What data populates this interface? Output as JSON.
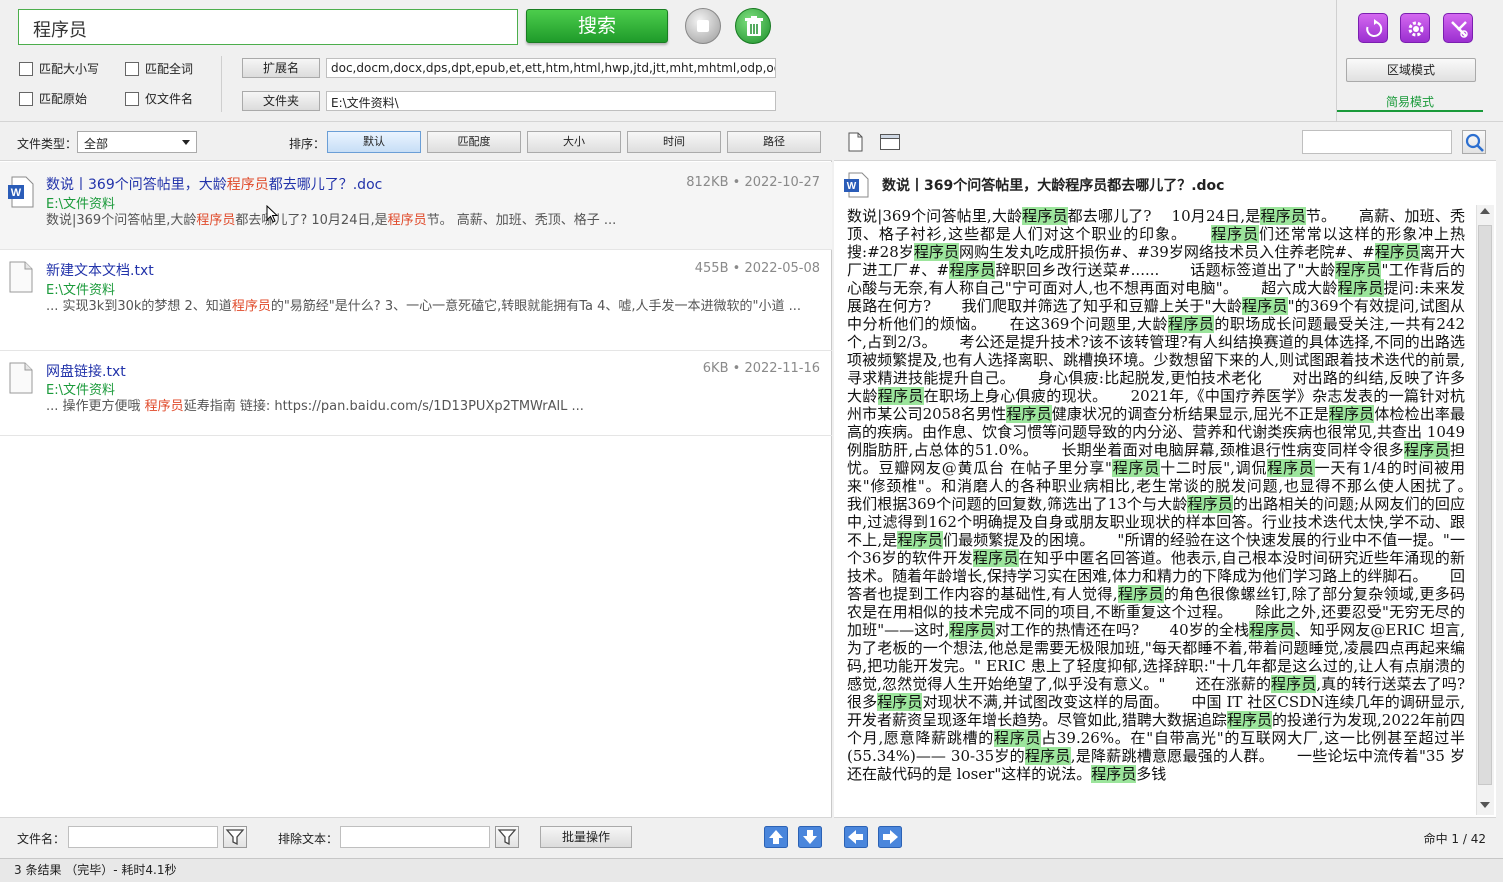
{
  "search": {
    "query": "程序员",
    "button_label": "搜索"
  },
  "options": {
    "match_case": "匹配大小写",
    "match_whole_word": "匹配全词",
    "match_original": "匹配原始",
    "filename_only": "仅文件名"
  },
  "extension": {
    "label": "扩展名",
    "value": "doc,docm,docx,dps,dpt,epub,et,ett,htm,html,hwp,jtd,jtt,mht,mhtml,odp,ods,odt,ofd,"
  },
  "folder": {
    "label": "文件夹",
    "value": "E:\\文件资料\\"
  },
  "modes": {
    "region": "区域模式",
    "simple": "简易模式"
  },
  "filter_bar": {
    "file_type_label": "文件类型：",
    "file_type_value": "全部",
    "sort_label": "排序：",
    "sort_options": [
      "默认",
      "匹配度",
      "大小",
      "时间",
      "路径"
    ]
  },
  "results": [
    {
      "title_pre": "数说丨369个问答帖里，大龄",
      "title_hl": "程序员",
      "title_post": "都去哪儿了？.doc",
      "path": "E:\\文件资料",
      "snippet_pre": "数说|369个问答帖里,大龄",
      "snippet_hl1": "程序员",
      "snippet_mid": "都去哪儿了? 10月24日,是",
      "snippet_hl2": "程序员",
      "snippet_post": "节。 高薪、加班、秃顶、格子 ...",
      "size": "812KB",
      "date": "2022-10-27"
    },
    {
      "title": "新建文本文档.txt",
      "path": "E:\\文件资料",
      "snippet_pre": "... 实现3k到30k的梦想 2、知道",
      "snippet_hl1": "程序员",
      "snippet_post": "的\"易筋经\"是什么? 3、一心一意死磕它,转眼就能拥有Ta 4、嘘,人手发一本进微软的\"小道 ...",
      "size": "455B",
      "date": "2022-05-08"
    },
    {
      "title": "网盘链接.txt",
      "path": "E:\\文件资料",
      "snippet_pre": "... 操作更方便哦 ",
      "snippet_hl1": "程序员",
      "snippet_post": "延寿指南 链接: https://pan.baidu.com/s/1D13PUXp2TMWrAlL ...",
      "size": "6KB",
      "date": "2022-11-16"
    }
  ],
  "bottom_left": {
    "filename_label": "文件名：",
    "exclude_label": "排除文本：",
    "batch_label": "批量操作"
  },
  "status": "3 条结果 （完毕）- 耗时4.1秒",
  "preview": {
    "title": "数说丨369个问答帖里，大龄程序员都去哪儿了？.doc",
    "hits": "命中 1 / 42",
    "body": [
      [
        "数说|369个问答帖里,大龄",
        0
      ],
      [
        "程序员",
        1
      ],
      [
        "都去哪儿了? 　10月24日,是",
        0
      ],
      [
        "程序员",
        1
      ],
      [
        "节。　　高薪、加班、秃顶、格子衬衫,这些都是人们对这个职业的印象。　　",
        0
      ],
      [
        "程序员",
        1
      ],
      [
        "们还常常以这样的形象冲上热搜:#28岁",
        0
      ],
      [
        "程序员",
        1
      ],
      [
        "网购生发丸吃成肝损伤#、#39岁网络技术员入住养老院#、#",
        0
      ],
      [
        "程序员",
        1
      ],
      [
        "离开大厂进工厂#、#",
        0
      ],
      [
        "程序员",
        1
      ],
      [
        "辞职回乡改行送菜#......　　话题标签道出了\"大龄",
        0
      ],
      [
        "程序员",
        1
      ],
      [
        "\"工作背后的心酸与无奈,有人称自己\"宁可面对人,也不想再面对电脑\"。　　超六成大龄",
        0
      ],
      [
        "程序员",
        1
      ],
      [
        "提问:未来发展路在何方?　　我们爬取并筛选了知乎和豆瓣上关于\"大龄",
        0
      ],
      [
        "程序员",
        1
      ],
      [
        "\"的369个有效提问,试图从中分析他们的烦恼。　　在这369个问题里,大龄",
        0
      ],
      [
        "程序员",
        1
      ],
      [
        "的职场成长问题最受关注,一共有242个,占到2/3。　　考公还是提升技术?该不该转管理?有人纠结换赛道的具体选择,不同的出路选项被频繁提及,也有人选择离职、跳槽换环境。少数想留下来的人,则试图跟着技术迭代的前景,寻求精进技能提升自己。　　身心俱疲:比起脱发,更怕技术老化　　对出路的纠结,反映了许多大龄",
        0
      ],
      [
        "程序员",
        1
      ],
      [
        "在职场上身心俱疲的现状。　　2021年,《中国疗养医学》杂志发表的一篇针对杭州市某公司2058名男性",
        0
      ],
      [
        "程序员",
        1
      ],
      [
        "健康状况的调查分析结果显示,屈光不正是",
        0
      ],
      [
        "程序员",
        1
      ],
      [
        "体检检出率最高的疾病。由作息、饮食习惯等问题导致的内分泌、营养和代谢类疾病也很常见,共查出 1049例脂肪肝,占总体的51.0%。　　长期坐着面对电脑屏幕,颈椎退行性病变同样令很多",
        0
      ],
      [
        "程序员",
        1
      ],
      [
        "担忧。豆瓣网友@黄瓜台 在帖子里分享\"",
        0
      ],
      [
        "程序员",
        1
      ],
      [
        "十二时辰\",调侃",
        0
      ],
      [
        "程序员",
        1
      ],
      [
        "一天有1/4的时间被用来\"修颈椎\"。和消磨人的各种职业病相比,老生常谈的脱发问题,也显得不那么使人困扰了。　　我们根据369个问题的回复数,筛选出了13个与大龄",
        0
      ],
      [
        "程序员",
        1
      ],
      [
        "的出路相关的问题;从网友们的回应中,过滤得到162个明确提及自身或朋友职业现状的样本回答。行业技术迭代太快,学不动、跟不上,是",
        0
      ],
      [
        "程序员",
        1
      ],
      [
        "们最频繁提及的困境。　　\"所谓的经验在这个快速发展的行业中不值一提。\"一个36岁的软件开发",
        0
      ],
      [
        "程序员",
        1
      ],
      [
        "在知乎中匿名回答道。他表示,自己根本没时间研究近些年涌现的新技术。随着年龄增长,保持学习实在困难,体力和精力的下降成为他们学习路上的绊脚石。　　回答者也提到工作内容的基础性,有人觉得,",
        0
      ],
      [
        "程序员",
        1
      ],
      [
        "的角色很像螺丝钉,除了部分复杂领域,更多码农是在用相似的技术完成不同的项目,不断重复这个过程。　　除此之外,还要忍受\"无穷无尽的加班\"——这时,",
        0
      ],
      [
        "程序员",
        1
      ],
      [
        "对工作的热情还在吗?　　40岁的全栈",
        0
      ],
      [
        "程序员",
        1
      ],
      [
        "、知乎网友@ERIC 坦言,为了老板的一个想法,他总是需要无极限加班,\"每天都睡不着,带着问题睡觉,凌晨四点再起来编码,把功能开发完。\" ERIC 患上了轻度抑郁,选择辞职:\"十几年都是这么过的,让人有点崩溃的感觉,忽然觉得人生开始绝望了,似乎没有意义。\"　　还在涨薪的",
        0
      ],
      [
        "程序员",
        1
      ],
      [
        ",真的转行送菜去了吗?　　很多",
        0
      ],
      [
        "程序员",
        1
      ],
      [
        "对现状不满,并试图改变这样的局面。　　中国 IT 社区CSDN连续几年的调研显示,开发者薪资呈现逐年增长趋势。尽管如此,猎聘大数据追踪",
        0
      ],
      [
        "程序员",
        1
      ],
      [
        "的投递行为发现,2022年前四个月,愿意降薪跳槽的",
        0
      ],
      [
        "程序员",
        1
      ],
      [
        "占39.26%。在\"自带高光\"的互联网大厂,这一比例甚至超过半(55.34%)—— 30-35岁的",
        0
      ],
      [
        "程序员",
        1
      ],
      [
        ",是降薪跳槽意愿最强的人群。　　一些论坛中流传着\"35 岁还在敲代码的是 loser\"这样的说法。",
        0
      ],
      [
        "程序员",
        1
      ],
      [
        "多钱",
        0
      ]
    ]
  }
}
